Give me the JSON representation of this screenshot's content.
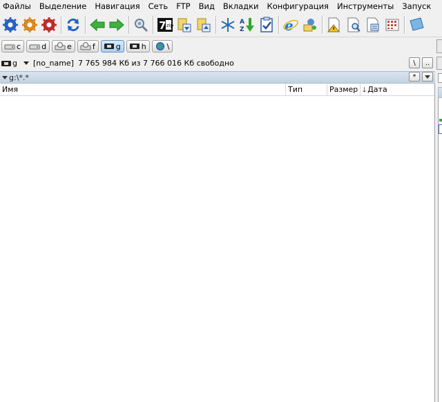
{
  "menu": [
    "Файлы",
    "Выделение",
    "Навигация",
    "Сеть",
    "FTP",
    "Вид",
    "Вкладки",
    "Конфигурация",
    "Инструменты",
    "Запуск"
  ],
  "toolbar_icons": [
    "gear-blue-icon",
    "gear-orange-icon",
    "gear-red-icon",
    "refresh-icon",
    "arrow-left-icon",
    "arrow-right-icon",
    "search-gear-icon",
    "7zip-icon",
    "pack-icon",
    "unpack-icon",
    "snowflake-icon",
    "sort-az-icon",
    "clipboard-check-icon",
    "ie-icon",
    "network-user-icon",
    "doc-warning-icon",
    "doc-view-icon",
    "doc-edit-icon",
    "grid-icon",
    "book-icon"
  ],
  "drives": [
    {
      "letter": "c",
      "active": false
    },
    {
      "letter": "d",
      "active": false
    },
    {
      "letter": "e",
      "active": false
    },
    {
      "letter": "f",
      "active": false
    },
    {
      "letter": "g",
      "active": true
    },
    {
      "letter": "h",
      "active": false
    },
    {
      "letter": "\\",
      "active": false
    }
  ],
  "info": {
    "drive": "g",
    "label": "[no_name]",
    "space": "7 765 984 Кб из 7 766 016 Кб свободно",
    "root_btn": "\\",
    "up_btn": ".."
  },
  "path": {
    "text": "g:\\*.*",
    "star_btn": "*"
  },
  "columns": {
    "name": "Имя",
    "type": "Тип",
    "size": "Размер",
    "date": "Дата"
  },
  "colors": {
    "active_drive": "#a9d1f3",
    "path_bar": "#c3d2e1"
  }
}
